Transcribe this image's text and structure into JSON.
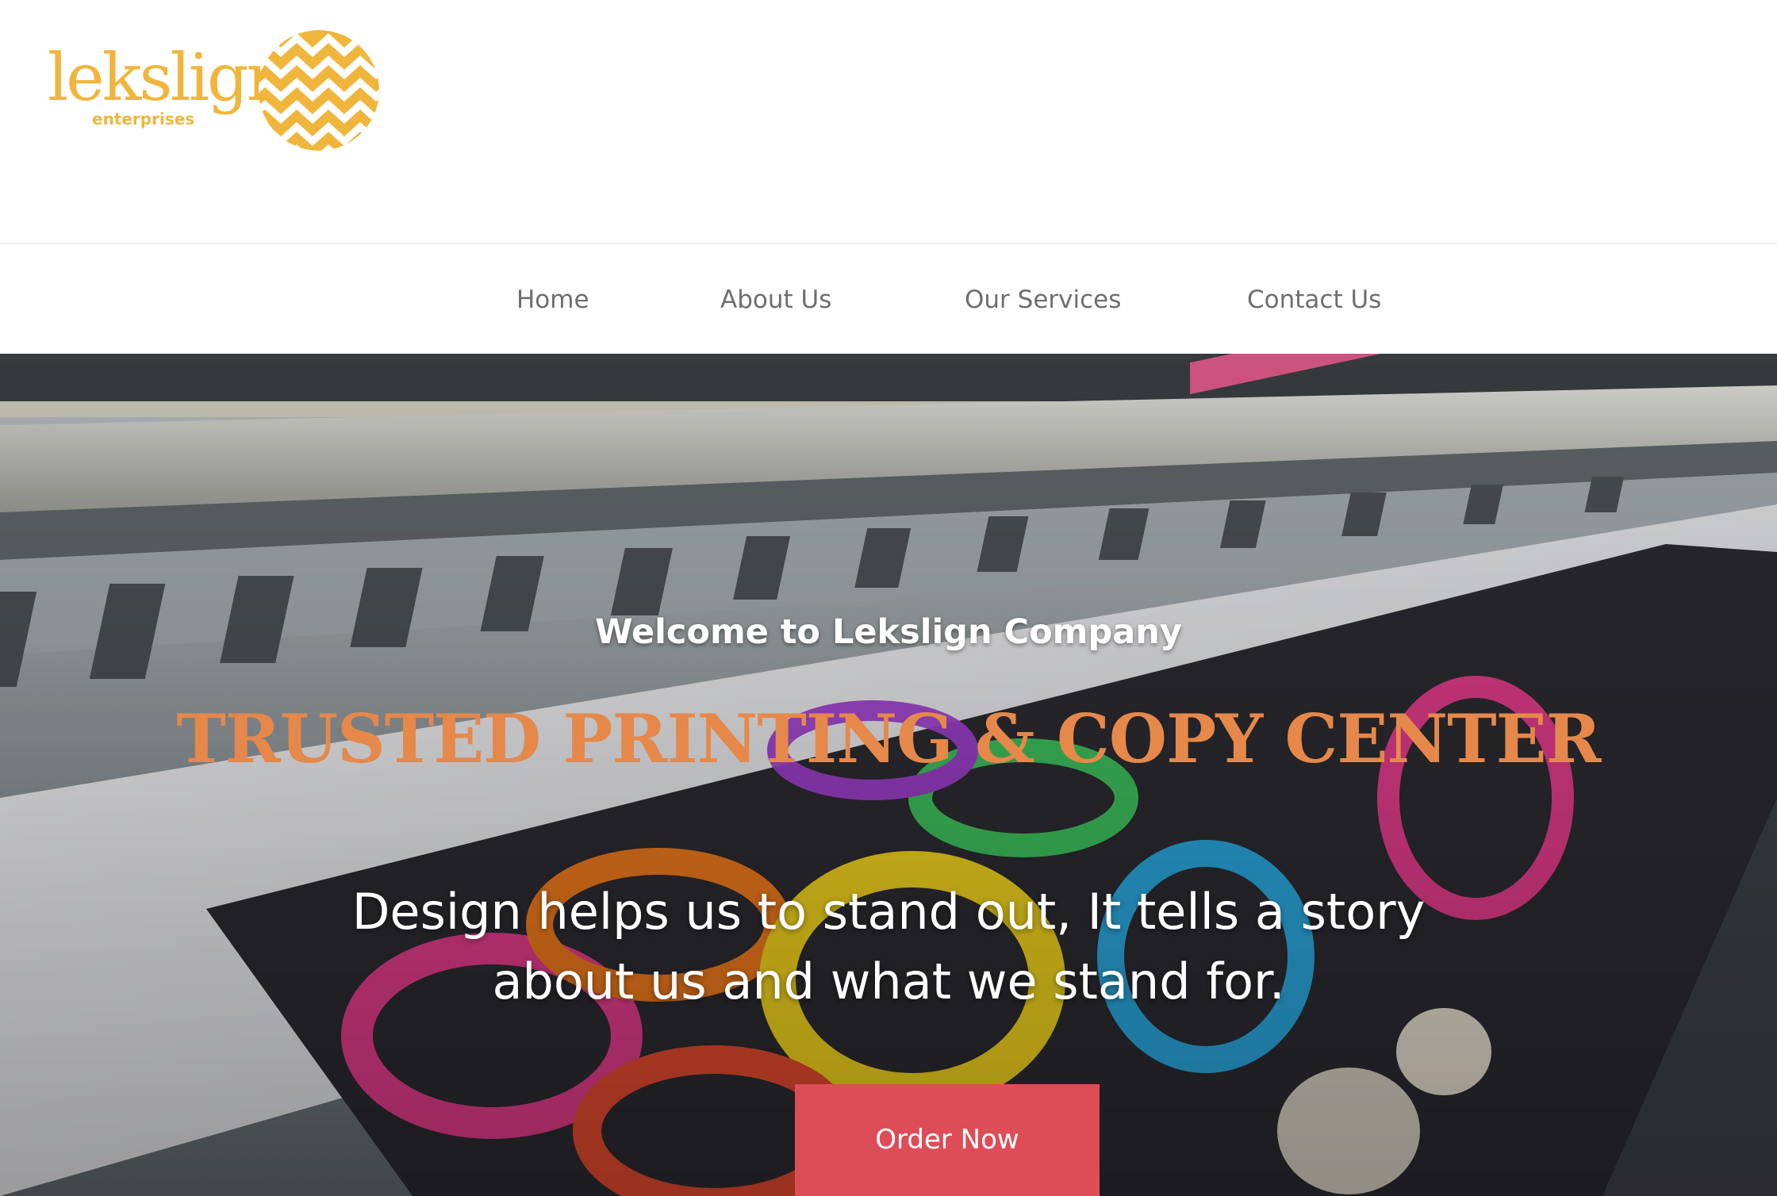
{
  "brand": {
    "logo_text": "lekslign",
    "logo_sub": "enterprises",
    "logo_color": "#f0b63c"
  },
  "nav": {
    "items": [
      {
        "label": "Home"
      },
      {
        "label": "About Us"
      },
      {
        "label": "Our Services"
      },
      {
        "label": "Contact Us"
      }
    ]
  },
  "hero": {
    "welcome": "Welcome to Lekslign Company",
    "title": "TRUSTED PRINTING & COPY CENTER",
    "tagline": "Design helps us to stand out, It tells a story about us and what we stand for.",
    "button_label": "Order Now",
    "background_image": "large-format-printer-photo",
    "title_color": "#e5884a",
    "button_color": "#dd4d58"
  }
}
